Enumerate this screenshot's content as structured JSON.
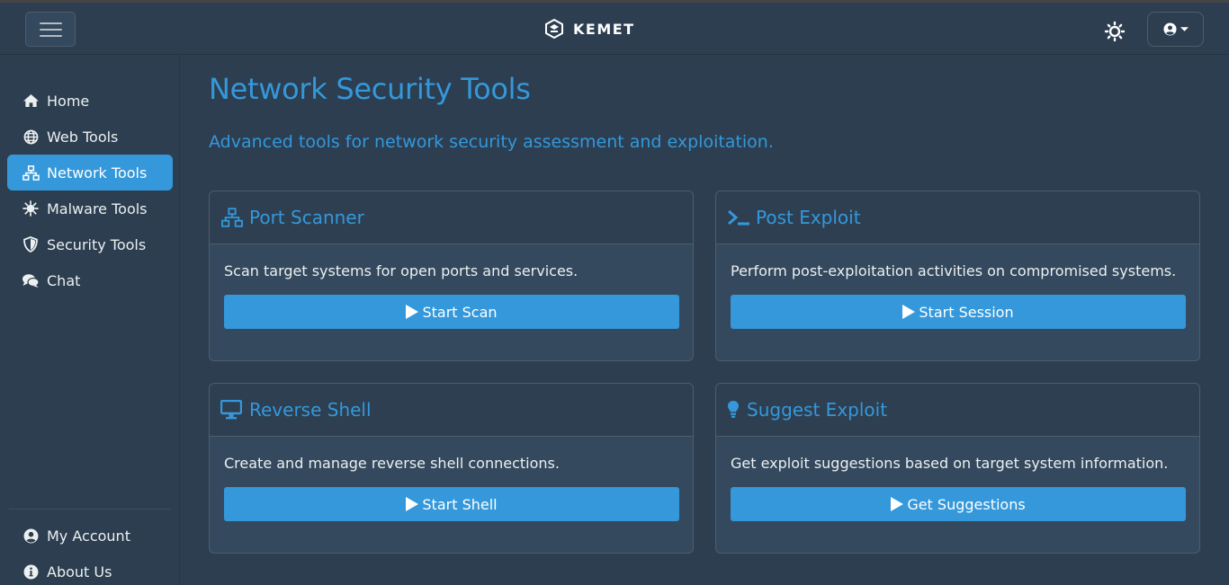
{
  "brand": {
    "name": "KEMET"
  },
  "colors": {
    "accent": "#3498db",
    "background": "#2c3e50",
    "card": "#34495e",
    "text": "#ecf0f1"
  },
  "navbar": {
    "toggle_icon": "hamburger-icon",
    "theme_icon": "sun-icon",
    "user_icon": "user-circle-icon"
  },
  "sidebar": {
    "items": [
      {
        "label": "Home",
        "icon": "home-icon"
      },
      {
        "label": "Web Tools",
        "icon": "globe-icon"
      },
      {
        "label": "Network Tools",
        "icon": "network-icon",
        "active": true
      },
      {
        "label": "Malware Tools",
        "icon": "virus-icon"
      },
      {
        "label": "Security Tools",
        "icon": "shield-icon"
      },
      {
        "label": "Chat",
        "icon": "comments-icon"
      }
    ],
    "bottom": [
      {
        "label": "My Account",
        "icon": "user-circle-icon"
      },
      {
        "label": "About Us",
        "icon": "info-circle-icon"
      }
    ]
  },
  "page": {
    "title": "Network Security Tools",
    "subtitle": "Advanced tools for network security assessment and exploitation."
  },
  "cards": [
    {
      "title": "Port Scanner",
      "icon": "network-icon",
      "text": "Scan target systems for open ports and services.",
      "button": "Start Scan"
    },
    {
      "title": "Post Exploit",
      "icon": "terminal-icon",
      "text": "Perform post-exploitation activities on compromised systems.",
      "button": "Start Session"
    },
    {
      "title": "Reverse Shell",
      "icon": "desktop-icon",
      "text": "Create and manage reverse shell connections.",
      "button": "Start Shell"
    },
    {
      "title": "Suggest Exploit",
      "icon": "lightbulb-icon",
      "text": "Get exploit suggestions based on target system information.",
      "button": "Get Suggestions"
    }
  ]
}
